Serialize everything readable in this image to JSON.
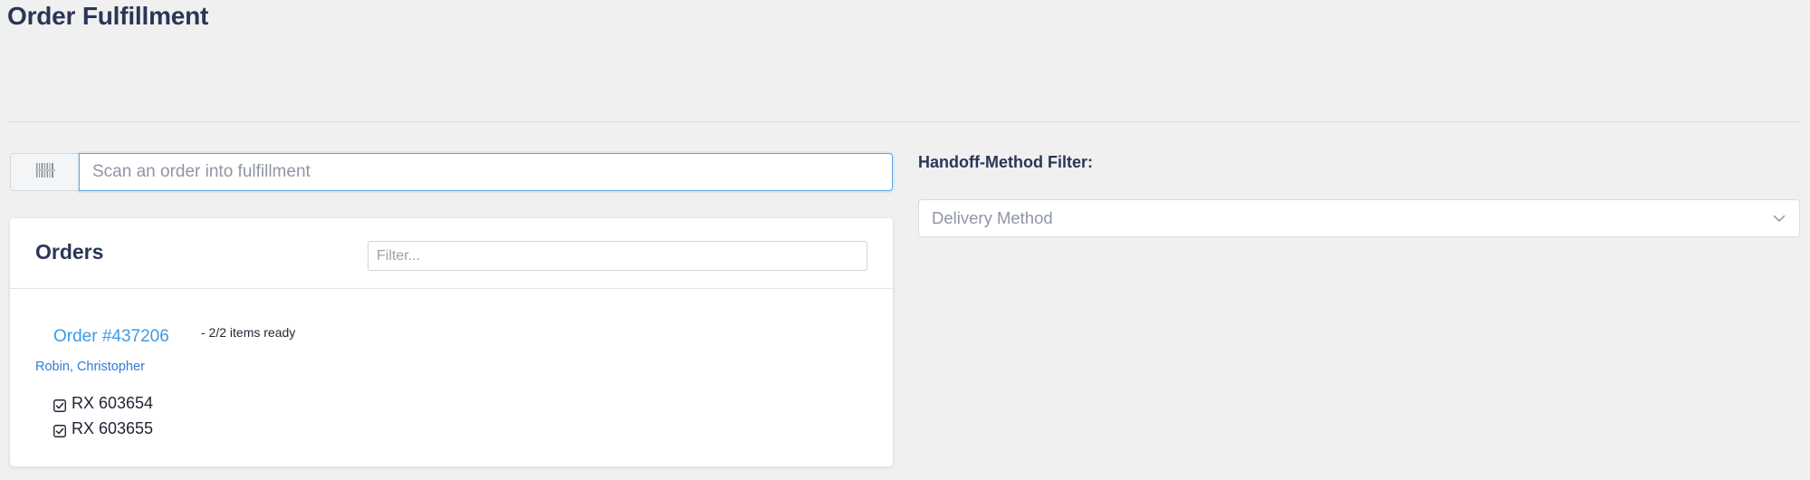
{
  "page": {
    "title": "Order Fulfillment"
  },
  "scan": {
    "icon": "barcode-icon",
    "placeholder": "Scan an order into fulfillment",
    "value": ""
  },
  "orders": {
    "title": "Orders",
    "filter_placeholder": "Filter...",
    "items": [
      {
        "order_label": "Order #437206",
        "status": "- 2/2 items ready",
        "customer": "Robin, Christopher",
        "rx": [
          {
            "label": "RX 603654",
            "checked": true
          },
          {
            "label": "RX 603655",
            "checked": true
          }
        ]
      }
    ]
  },
  "handoff": {
    "label": "Handoff-Method Filter:",
    "select_placeholder": "Delivery Method",
    "chevron_icon": "chevron-down-icon"
  },
  "colors": {
    "background": "#f0f0f0",
    "title": "#2b3656",
    "link": "#3d9be5",
    "focus_border": "#5aa7e8"
  }
}
